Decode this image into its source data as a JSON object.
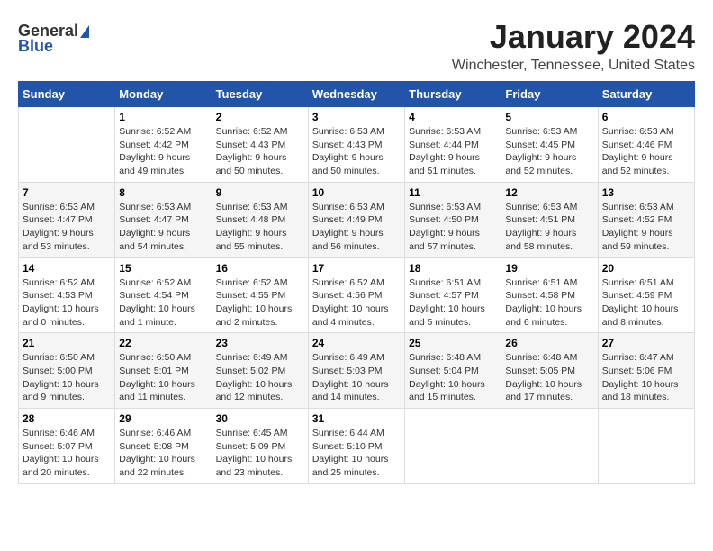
{
  "header": {
    "month_year": "January 2024",
    "location": "Winchester, Tennessee, United States"
  },
  "logo": {
    "general": "General",
    "blue": "Blue"
  },
  "days_of_week": [
    "Sunday",
    "Monday",
    "Tuesday",
    "Wednesday",
    "Thursday",
    "Friday",
    "Saturday"
  ],
  "weeks": [
    [
      {
        "day": "",
        "info": ""
      },
      {
        "day": "1",
        "info": "Sunrise: 6:52 AM\nSunset: 4:42 PM\nDaylight: 9 hours\nand 49 minutes."
      },
      {
        "day": "2",
        "info": "Sunrise: 6:52 AM\nSunset: 4:43 PM\nDaylight: 9 hours\nand 50 minutes."
      },
      {
        "day": "3",
        "info": "Sunrise: 6:53 AM\nSunset: 4:43 PM\nDaylight: 9 hours\nand 50 minutes."
      },
      {
        "day": "4",
        "info": "Sunrise: 6:53 AM\nSunset: 4:44 PM\nDaylight: 9 hours\nand 51 minutes."
      },
      {
        "day": "5",
        "info": "Sunrise: 6:53 AM\nSunset: 4:45 PM\nDaylight: 9 hours\nand 52 minutes."
      },
      {
        "day": "6",
        "info": "Sunrise: 6:53 AM\nSunset: 4:46 PM\nDaylight: 9 hours\nand 52 minutes."
      }
    ],
    [
      {
        "day": "7",
        "info": "Sunrise: 6:53 AM\nSunset: 4:47 PM\nDaylight: 9 hours\nand 53 minutes."
      },
      {
        "day": "8",
        "info": "Sunrise: 6:53 AM\nSunset: 4:47 PM\nDaylight: 9 hours\nand 54 minutes."
      },
      {
        "day": "9",
        "info": "Sunrise: 6:53 AM\nSunset: 4:48 PM\nDaylight: 9 hours\nand 55 minutes."
      },
      {
        "day": "10",
        "info": "Sunrise: 6:53 AM\nSunset: 4:49 PM\nDaylight: 9 hours\nand 56 minutes."
      },
      {
        "day": "11",
        "info": "Sunrise: 6:53 AM\nSunset: 4:50 PM\nDaylight: 9 hours\nand 57 minutes."
      },
      {
        "day": "12",
        "info": "Sunrise: 6:53 AM\nSunset: 4:51 PM\nDaylight: 9 hours\nand 58 minutes."
      },
      {
        "day": "13",
        "info": "Sunrise: 6:53 AM\nSunset: 4:52 PM\nDaylight: 9 hours\nand 59 minutes."
      }
    ],
    [
      {
        "day": "14",
        "info": "Sunrise: 6:52 AM\nSunset: 4:53 PM\nDaylight: 10 hours\nand 0 minutes."
      },
      {
        "day": "15",
        "info": "Sunrise: 6:52 AM\nSunset: 4:54 PM\nDaylight: 10 hours\nand 1 minute."
      },
      {
        "day": "16",
        "info": "Sunrise: 6:52 AM\nSunset: 4:55 PM\nDaylight: 10 hours\nand 2 minutes."
      },
      {
        "day": "17",
        "info": "Sunrise: 6:52 AM\nSunset: 4:56 PM\nDaylight: 10 hours\nand 4 minutes."
      },
      {
        "day": "18",
        "info": "Sunrise: 6:51 AM\nSunset: 4:57 PM\nDaylight: 10 hours\nand 5 minutes."
      },
      {
        "day": "19",
        "info": "Sunrise: 6:51 AM\nSunset: 4:58 PM\nDaylight: 10 hours\nand 6 minutes."
      },
      {
        "day": "20",
        "info": "Sunrise: 6:51 AM\nSunset: 4:59 PM\nDaylight: 10 hours\nand 8 minutes."
      }
    ],
    [
      {
        "day": "21",
        "info": "Sunrise: 6:50 AM\nSunset: 5:00 PM\nDaylight: 10 hours\nand 9 minutes."
      },
      {
        "day": "22",
        "info": "Sunrise: 6:50 AM\nSunset: 5:01 PM\nDaylight: 10 hours\nand 11 minutes."
      },
      {
        "day": "23",
        "info": "Sunrise: 6:49 AM\nSunset: 5:02 PM\nDaylight: 10 hours\nand 12 minutes."
      },
      {
        "day": "24",
        "info": "Sunrise: 6:49 AM\nSunset: 5:03 PM\nDaylight: 10 hours\nand 14 minutes."
      },
      {
        "day": "25",
        "info": "Sunrise: 6:48 AM\nSunset: 5:04 PM\nDaylight: 10 hours\nand 15 minutes."
      },
      {
        "day": "26",
        "info": "Sunrise: 6:48 AM\nSunset: 5:05 PM\nDaylight: 10 hours\nand 17 minutes."
      },
      {
        "day": "27",
        "info": "Sunrise: 6:47 AM\nSunset: 5:06 PM\nDaylight: 10 hours\nand 18 minutes."
      }
    ],
    [
      {
        "day": "28",
        "info": "Sunrise: 6:46 AM\nSunset: 5:07 PM\nDaylight: 10 hours\nand 20 minutes."
      },
      {
        "day": "29",
        "info": "Sunrise: 6:46 AM\nSunset: 5:08 PM\nDaylight: 10 hours\nand 22 minutes."
      },
      {
        "day": "30",
        "info": "Sunrise: 6:45 AM\nSunset: 5:09 PM\nDaylight: 10 hours\nand 23 minutes."
      },
      {
        "day": "31",
        "info": "Sunrise: 6:44 AM\nSunset: 5:10 PM\nDaylight: 10 hours\nand 25 minutes."
      },
      {
        "day": "",
        "info": ""
      },
      {
        "day": "",
        "info": ""
      },
      {
        "day": "",
        "info": ""
      }
    ]
  ]
}
